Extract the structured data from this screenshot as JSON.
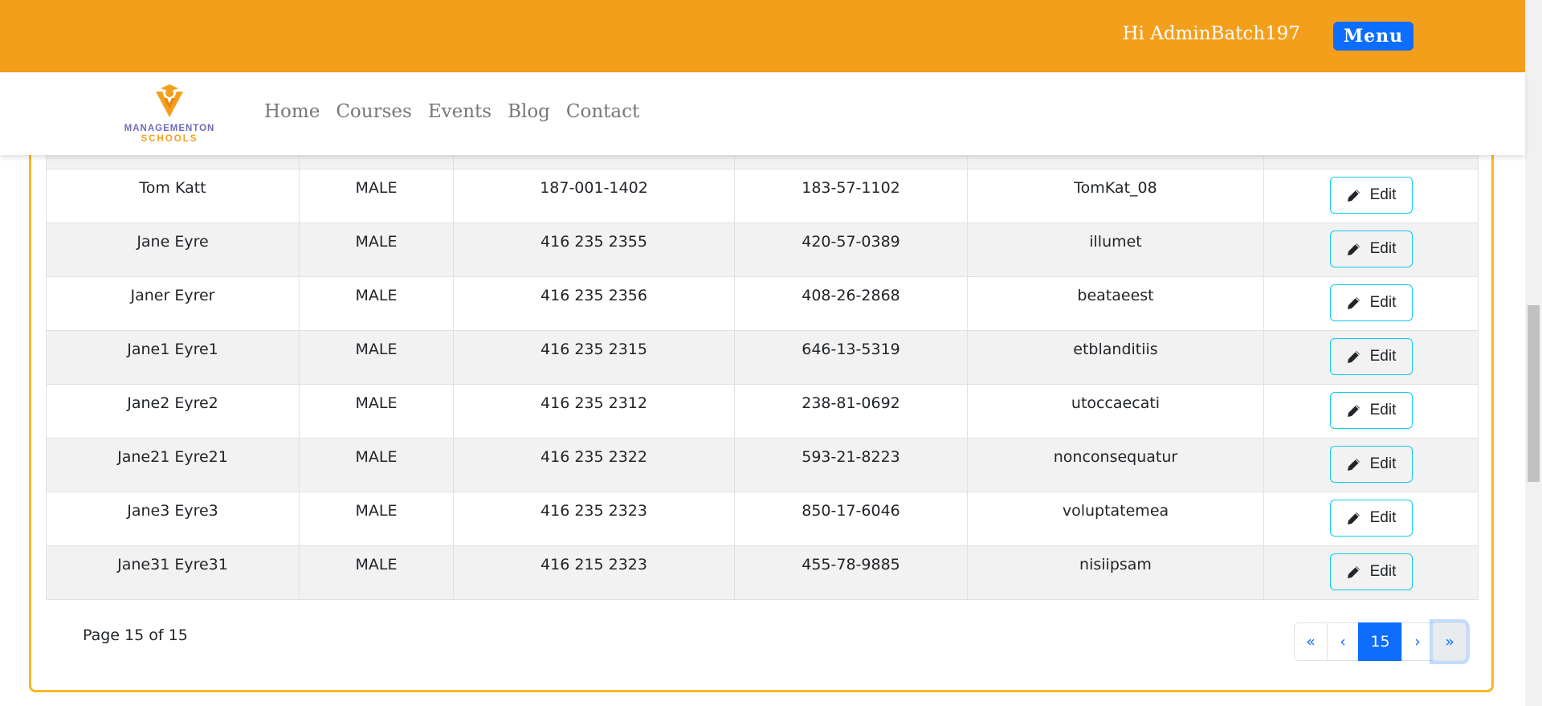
{
  "header": {
    "greeting": "Hi AdminBatch197",
    "menu_label": "Menu"
  },
  "logo": {
    "line1": "MANAGEMENTON",
    "line2": "SCHOOLS"
  },
  "nav": [
    "Home",
    "Courses",
    "Events",
    "Blog",
    "Contact"
  ],
  "table": {
    "edit_label": "Edit",
    "rows": [
      {
        "name": "Tom Katt",
        "gender": "MALE",
        "phone": "187-001-1402",
        "ssn": "183-57-1102",
        "username": "TomKat_08"
      },
      {
        "name": "Jane Eyre",
        "gender": "MALE",
        "phone": "416 235 2355",
        "ssn": "420-57-0389",
        "username": "illumet"
      },
      {
        "name": "Janer Eyrer",
        "gender": "MALE",
        "phone": "416 235 2356",
        "ssn": "408-26-2868",
        "username": "beataeest"
      },
      {
        "name": "Jane1 Eyre1",
        "gender": "MALE",
        "phone": "416 235 2315",
        "ssn": "646-13-5319",
        "username": "etblanditiis"
      },
      {
        "name": "Jane2 Eyre2",
        "gender": "MALE",
        "phone": "416 235 2312",
        "ssn": "238-81-0692",
        "username": "utoccaecati"
      },
      {
        "name": "Jane21 Eyre21",
        "gender": "MALE",
        "phone": "416 235 2322",
        "ssn": "593-21-8223",
        "username": "nonconsequatur"
      },
      {
        "name": "Jane3 Eyre3",
        "gender": "MALE",
        "phone": "416 235 2323",
        "ssn": "850-17-6046",
        "username": "voluptatemea"
      },
      {
        "name": "Jane31 Eyre31",
        "gender": "MALE",
        "phone": "416 215 2323",
        "ssn": "455-78-9885",
        "username": "nisiipsam"
      }
    ]
  },
  "pagination": {
    "page_text": "Page 15 of 15",
    "first": "«",
    "prev": "‹",
    "current": "15",
    "next": "›",
    "last": "»"
  },
  "colors": {
    "brand": "#f49f1c",
    "primary": "#0d6efd",
    "card_border": "#f7b727",
    "edit_border": "#0dcaf0"
  }
}
